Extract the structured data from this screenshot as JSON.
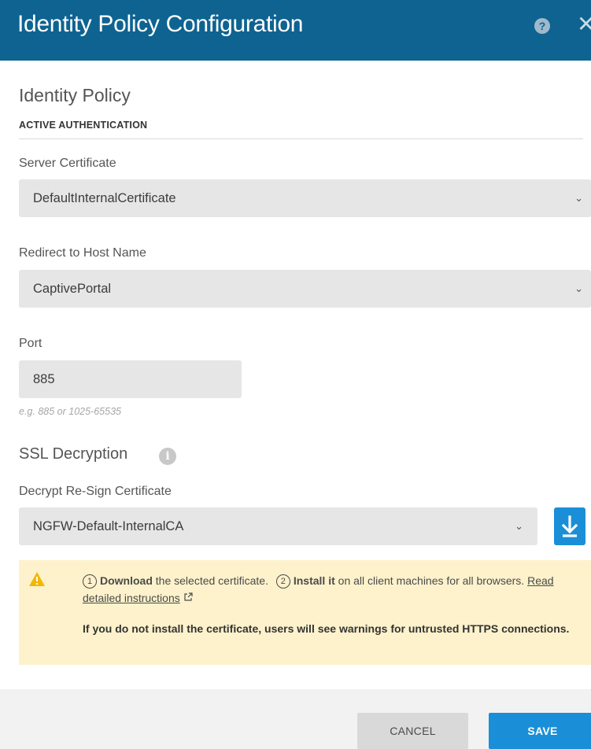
{
  "header": {
    "title": "Identity Policy Configuration",
    "help_glyph": "?",
    "close_glyph": "✕"
  },
  "identity_policy": {
    "section_title": "Identity Policy",
    "sub_heading": "ACTIVE AUTHENTICATION",
    "server_certificate": {
      "label": "Server Certificate",
      "value": "DefaultInternalCertificate"
    },
    "redirect_host": {
      "label": "Redirect to Host Name",
      "value": "CaptivePortal"
    },
    "port": {
      "label": "Port",
      "value": "885",
      "hint": "e.g. 885 or 1025-65535"
    }
  },
  "ssl_decryption": {
    "title": "SSL Decryption",
    "info_glyph": "i",
    "resign_cert": {
      "label": "Decrypt Re-Sign Certificate",
      "value": "NGFW-Default-InternalCA"
    }
  },
  "chevron_glyph": "⌄",
  "warning": {
    "step1_num": "1",
    "step1_bold": "Download",
    "step1_text": " the selected certificate.",
    "step2_num": "2",
    "step2_bold": "Install it",
    "step2_text": " on all client machines for all browsers. ",
    "link_text": "Read detailed instructions",
    "note": "If you do not install the certificate, users will see warnings for untrusted HTTPS connections."
  },
  "footer": {
    "cancel_label": "CANCEL",
    "save_label": "SAVE"
  },
  "colors": {
    "header_bg": "#0e6391",
    "primary": "#1a8fd8",
    "warning_bg": "#fdf2cc",
    "warning_icon": "#f2b705"
  }
}
